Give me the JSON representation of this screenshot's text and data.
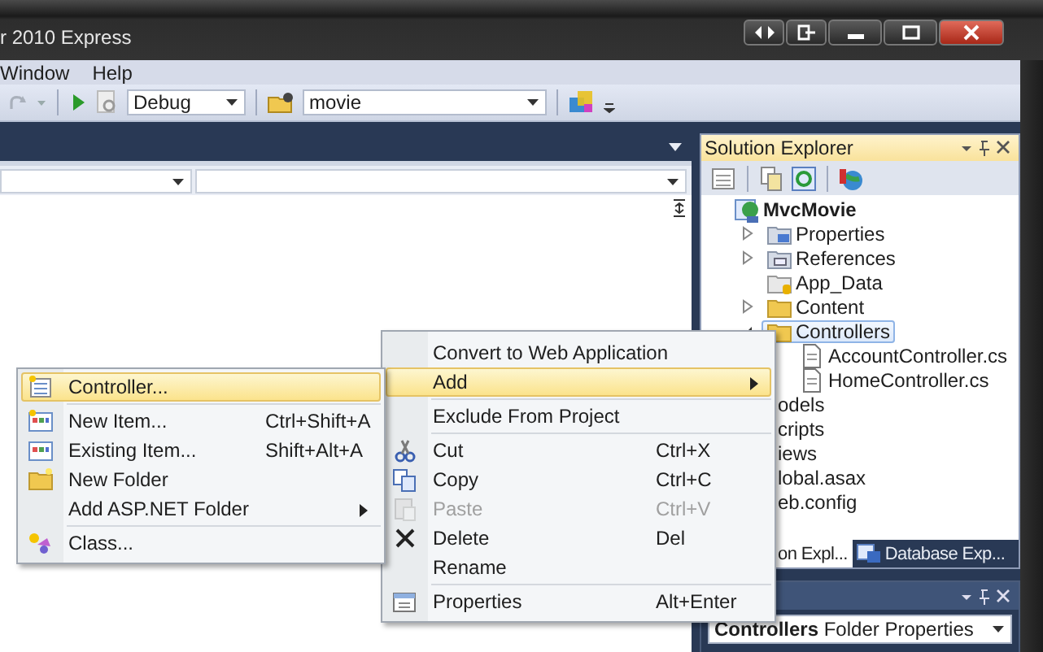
{
  "window": {
    "title": "r 2010 Express"
  },
  "menu_bar": [
    "Window",
    "Help"
  ],
  "toolbar": {
    "configuration": "Debug",
    "find_box": "movie"
  },
  "solution_explorer": {
    "title": "Solution Explorer",
    "tree": [
      {
        "label": "MvcMovie",
        "kind": "project",
        "children": [
          {
            "label": "Properties",
            "kind": "properties",
            "expanded": false
          },
          {
            "label": "References",
            "kind": "references",
            "expanded": false
          },
          {
            "label": "App_Data",
            "kind": "data-folder"
          },
          {
            "label": "Content",
            "kind": "folder",
            "expanded": false
          },
          {
            "label": "Controllers",
            "kind": "folder",
            "expanded": true,
            "selected": true,
            "children": [
              {
                "label": "AccountController.cs",
                "kind": "file"
              },
              {
                "label": "HomeController.cs",
                "kind": "file"
              }
            ]
          },
          {
            "label": "odels",
            "kind": "covered"
          },
          {
            "label": "cripts",
            "kind": "covered"
          },
          {
            "label": "iews",
            "kind": "covered"
          },
          {
            "label": "lobal.asax",
            "kind": "covered"
          },
          {
            "label": "eb.config",
            "kind": "covered"
          }
        ]
      }
    ],
    "tabs": [
      {
        "label": "on Expl...",
        "selected": true
      },
      {
        "label": "Database Exp...",
        "selected": false
      }
    ]
  },
  "properties": {
    "selector": "**Controllers** Folder Properties"
  },
  "context_menu": [
    {
      "label": "Convert to Web Application",
      "selected": false,
      "disabled": false
    },
    {
      "label": "Add",
      "selected": true,
      "disabled": false,
      "submenu": true,
      "separator_after": true
    },
    {
      "label": "Exclude From Project",
      "selected": false,
      "disabled": false,
      "separator_after": true
    },
    {
      "label": "Cut",
      "shortcut": "Ctrl+X",
      "selected": false,
      "disabled": false
    },
    {
      "label": "Copy",
      "shortcut": "Ctrl+C",
      "selected": false,
      "disabled": false
    },
    {
      "label": "Paste",
      "shortcut": "Ctrl+V",
      "selected": false,
      "disabled": true
    },
    {
      "label": "Delete",
      "shortcut": "Del",
      "selected": false,
      "disabled": false
    },
    {
      "label": "Rename",
      "selected": false,
      "disabled": false,
      "separator_after": true
    },
    {
      "label": "Properties",
      "shortcut": "Alt+Enter",
      "selected": false,
      "disabled": false
    }
  ],
  "add_submenu": [
    {
      "label": "Controller...",
      "selected": true,
      "disabled": false,
      "separator_after": true
    },
    {
      "label": "New Item...",
      "shortcut": "Ctrl+Shift+A",
      "selected": false,
      "disabled": false
    },
    {
      "label": "Existing Item...",
      "shortcut": "Shift+Alt+A",
      "selected": false,
      "disabled": false
    },
    {
      "label": "New Folder",
      "selected": false,
      "disabled": false
    },
    {
      "label": "Add ASP.NET Folder",
      "selected": false,
      "disabled": false,
      "submenu": true,
      "separator_after": true
    },
    {
      "label": "Class...",
      "selected": false,
      "disabled": false
    }
  ]
}
